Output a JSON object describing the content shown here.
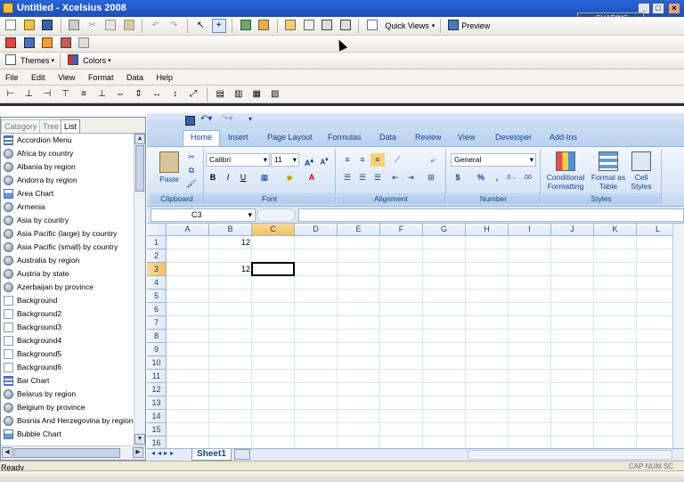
{
  "window": {
    "title": "Untitled - Xcelsius 2008",
    "sharing_label": "SHARING"
  },
  "toolbar": {
    "quick_views": "Quick Views",
    "preview": "Preview",
    "themes": "Themes",
    "colors": "Colors"
  },
  "menu": [
    "File",
    "Edit",
    "View",
    "Format",
    "Data",
    "Help"
  ],
  "components_panel": {
    "tabs": [
      "Category",
      "Tree",
      "List"
    ],
    "active_tab": "List",
    "items": [
      {
        "label": "Accordion Menu",
        "icon": "menu-icon"
      },
      {
        "label": "Africa by country",
        "icon": "globe-icon"
      },
      {
        "label": "Albania by region",
        "icon": "globe-icon"
      },
      {
        "label": "Andorra by region",
        "icon": "globe-icon"
      },
      {
        "label": "Area Chart",
        "icon": "chart-icon"
      },
      {
        "label": "Armenia",
        "icon": "globe-icon"
      },
      {
        "label": "Asia by country",
        "icon": "globe-icon"
      },
      {
        "label": "Asia Pacific (large) by country",
        "icon": "globe-icon"
      },
      {
        "label": "Asia Pacific (small) by country",
        "icon": "globe-icon"
      },
      {
        "label": "Australia by region",
        "icon": "globe-icon"
      },
      {
        "label": "Austria by state",
        "icon": "globe-icon"
      },
      {
        "label": "Azerbaijan by province",
        "icon": "globe-icon"
      },
      {
        "label": "Background",
        "icon": "background-icon"
      },
      {
        "label": "Background2",
        "icon": "background-icon"
      },
      {
        "label": "Background3",
        "icon": "background-icon"
      },
      {
        "label": "Background4",
        "icon": "background-icon"
      },
      {
        "label": "Background5",
        "icon": "background-icon"
      },
      {
        "label": "Background6",
        "icon": "background-icon"
      },
      {
        "label": "Bar Chart",
        "icon": "menu-icon"
      },
      {
        "label": "Belarus by region",
        "icon": "globe-icon"
      },
      {
        "label": "Belgium by province",
        "icon": "globe-icon"
      },
      {
        "label": "Bosnia And Herzegovina by region",
        "icon": "globe-icon"
      },
      {
        "label": "Bubble Chart",
        "icon": "chart-icon"
      }
    ]
  },
  "excel": {
    "ribbon_tabs": [
      "Home",
      "Insert",
      "Page Layout",
      "Formulas",
      "Data",
      "Review",
      "View",
      "Developer",
      "Add-Ins"
    ],
    "active_tab": "Home",
    "clipboard": {
      "paste": "Paste",
      "label": "Clipboard"
    },
    "font": {
      "name": "Calibri",
      "size": "11",
      "label": "Font"
    },
    "alignment": {
      "label": "Alignment"
    },
    "number": {
      "format": "General",
      "label": "Number"
    },
    "styles": {
      "conditional": "Conditional Formatting",
      "format_table": "Format as Table",
      "cell_styles": "Cell Styles",
      "label": "Styles"
    },
    "name_box": "C3",
    "fx": "fx",
    "columns": [
      "A",
      "B",
      "C",
      "D",
      "E",
      "F",
      "G",
      "H",
      "I",
      "J",
      "K",
      "L"
    ],
    "rows": [
      "1",
      "2",
      "3",
      "4",
      "5",
      "6",
      "7",
      "8",
      "9",
      "10",
      "11",
      "12",
      "13",
      "14",
      "15",
      "16"
    ],
    "cells": {
      "B1": "12",
      "B3": "12"
    },
    "sheet_tab": "Sheet1"
  },
  "status": {
    "text": "Ready",
    "indicators": "CAP NUM SC"
  }
}
